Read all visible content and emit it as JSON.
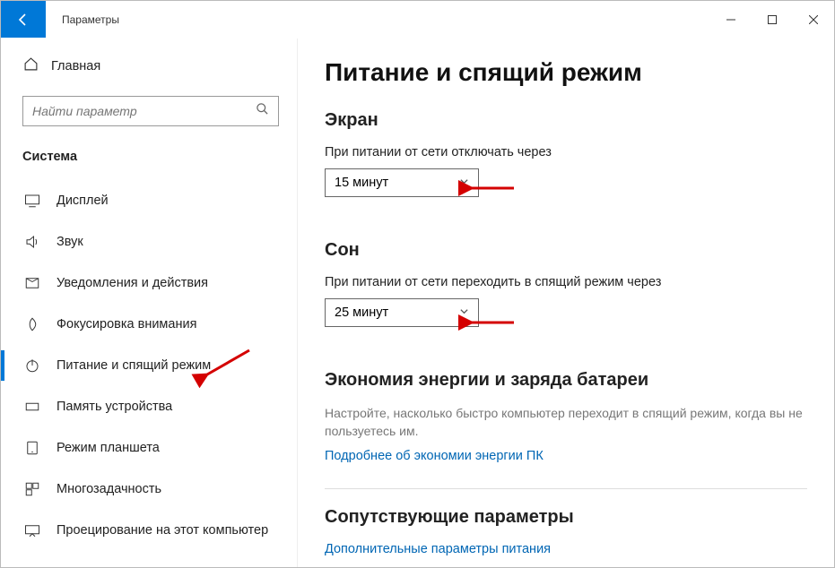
{
  "titlebar": {
    "app": "Параметры"
  },
  "sidebar": {
    "home": "Главная",
    "search_placeholder": "Найти параметр",
    "group": "Система",
    "items": [
      {
        "label": "Дисплей"
      },
      {
        "label": "Звук"
      },
      {
        "label": "Уведомления и действия"
      },
      {
        "label": "Фокусировка внимания"
      },
      {
        "label": "Питание и спящий режим"
      },
      {
        "label": "Память устройства"
      },
      {
        "label": "Режим планшета"
      },
      {
        "label": "Многозадачность"
      },
      {
        "label": "Проецирование на этот компьютер"
      }
    ]
  },
  "main": {
    "title": "Питание и спящий режим",
    "screen": {
      "heading": "Экран",
      "label": "При питании от сети отключать через",
      "value": "15 минут"
    },
    "sleep": {
      "heading": "Сон",
      "label": "При питании от сети переходить в спящий режим через",
      "value": "25 минут"
    },
    "energy": {
      "heading": "Экономия энергии и заряда батареи",
      "text": "Настройте, насколько быстро компьютер переходит в спящий режим, когда вы не пользуетесь им.",
      "link": "Подробнее об экономии энергии ПК"
    },
    "related": {
      "heading": "Сопутствующие параметры",
      "link": "Дополнительные параметры питания"
    }
  }
}
